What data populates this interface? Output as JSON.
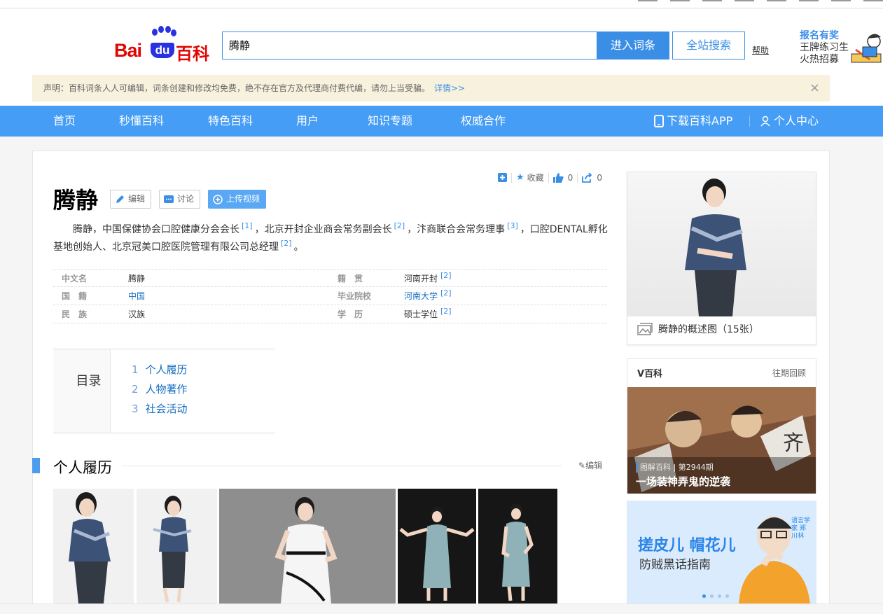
{
  "header": {
    "logo_bai": "Bai",
    "logo_du": "du",
    "logo_baike": "百科",
    "search_value": "腾静",
    "enter_button": "进入词条",
    "site_search_button": "全站搜索",
    "help": "帮助",
    "promo": {
      "title": "报名有奖",
      "line1": "王牌练习生",
      "line2": "火热招募"
    }
  },
  "notice": {
    "text": "声明：百科词条人人可编辑，词条创建和修改均免费，绝不存在官方及代理商付费代编，请勿上当受骗。",
    "more": "详情>>",
    "close": "×"
  },
  "nav": {
    "items": [
      "首页",
      "秒懂百科",
      "特色百科",
      "用户",
      "知识专题",
      "权威合作"
    ],
    "app": "下载百科APP",
    "user_center": "个人中心"
  },
  "tools": {
    "favorite": "收藏",
    "likes": "0",
    "shares": "0"
  },
  "entry": {
    "title": "腾静",
    "edit_btn": "编辑",
    "discuss_btn": "讨论",
    "upload_btn": "上传视频",
    "summary": [
      "腾静，中国保健协会口腔健康分会会长",
      "[1]",
      "，北京开封企业商会常务副会长",
      "[2]",
      "，汴商联合会常务理事",
      "[3]",
      "，口腔DENTAL孵化基地创始人、北京冠美口腔医院管理有限公司总经理",
      "[2]",
      "。"
    ]
  },
  "infobox": [
    {
      "k1": "中文名",
      "v1": "腾静",
      "r1": "",
      "k2": "籍　贯",
      "v2": "河南开封",
      "r2": "[2]"
    },
    {
      "k1": "国　籍",
      "v1": "中国",
      "r1": "",
      "k2": "毕业院校",
      "v2": "河南大学",
      "r2": "[2]"
    },
    {
      "k1": "民　族",
      "v1": "汉族",
      "r1": "",
      "k2": "学　历",
      "v2": "硕士学位",
      "r2": "[2]"
    }
  ],
  "toc": {
    "label": "目录",
    "items": [
      {
        "n": "1",
        "t": "个人履历"
      },
      {
        "n": "2",
        "t": "人物著作"
      },
      {
        "n": "3",
        "t": "社会活动"
      }
    ]
  },
  "section": {
    "title": "个人履历",
    "edit": "编辑"
  },
  "sidebar": {
    "album_caption": "腾静的概述图（15张）",
    "vbaike": {
      "title": "V百科",
      "more": "往期回顾",
      "sub": "图解百科 | 第2944期",
      "headline": "一场装神弄鬼的逆袭"
    },
    "ad": {
      "line1": "搓皮儿 帽花儿",
      "line2": "防贼黑话指南",
      "names": "语言学家 郑川林"
    }
  },
  "colors": {
    "accent": "#3a8ee6",
    "nav": "#459df5",
    "brand_red": "#e10602",
    "brand_blue": "#2932e1"
  }
}
